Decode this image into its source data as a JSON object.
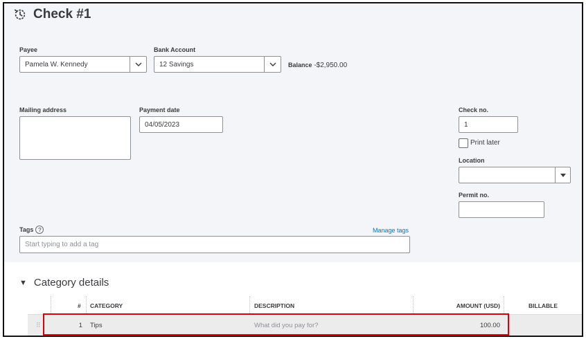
{
  "page": {
    "title": "Check #1"
  },
  "payee": {
    "label": "Payee",
    "value": "Pamela W. Kennedy"
  },
  "bank_account": {
    "label": "Bank Account",
    "value": "12 Savings",
    "balance_label": "Balance",
    "balance_value": "-$2,950.00"
  },
  "mailing_address": {
    "label": "Mailing address",
    "value": ""
  },
  "payment_date": {
    "label": "Payment date",
    "value": "04/05/2023"
  },
  "check_no": {
    "label": "Check no.",
    "value": "1"
  },
  "print_later": {
    "label": "Print later",
    "checked": false
  },
  "location": {
    "label": "Location",
    "value": ""
  },
  "permit_no": {
    "label": "Permit no.",
    "value": ""
  },
  "tags": {
    "label": "Tags",
    "help": "?",
    "manage_link": "Manage tags",
    "placeholder": "Start typing to add a tag"
  },
  "category_details": {
    "title": "Category details",
    "columns": [
      "#",
      "CATEGORY",
      "DESCRIPTION",
      "AMOUNT (USD)",
      "BILLABLE"
    ],
    "rows": [
      {
        "num": "1",
        "category": "Tips",
        "description_placeholder": "What did you pay for?",
        "amount": "100.00",
        "billable": ""
      }
    ]
  },
  "colors": {
    "accent_link": "#0077c5",
    "highlight": "#d9000d"
  }
}
